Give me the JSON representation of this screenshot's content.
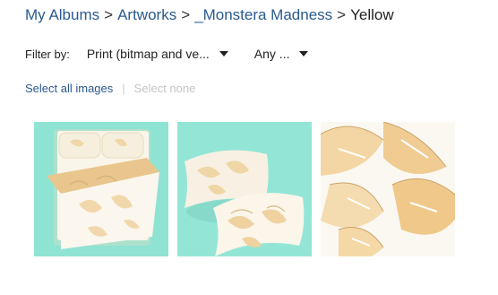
{
  "breadcrumb": {
    "items": [
      "My Albums",
      "Artworks",
      "_Monstera Madness"
    ],
    "separator": ">",
    "current": "Yellow"
  },
  "filters": {
    "label": "Filter by:",
    "type_selected": "Print (bitmap and ve...",
    "second_selected": "Any ..."
  },
  "selection": {
    "select_all": "Select all images",
    "select_none": "Select none"
  },
  "images": [
    {
      "subject": "duvet cover bedding with yellow monstera print"
    },
    {
      "subject": "two pillow shams with yellow monstera print"
    },
    {
      "subject": "yellow monstera leaf pattern tile"
    }
  ],
  "colors": {
    "link": "#2a5a8e",
    "mint_background": "#8fe3d2",
    "leaf_yellow": "#f2d6a0"
  }
}
